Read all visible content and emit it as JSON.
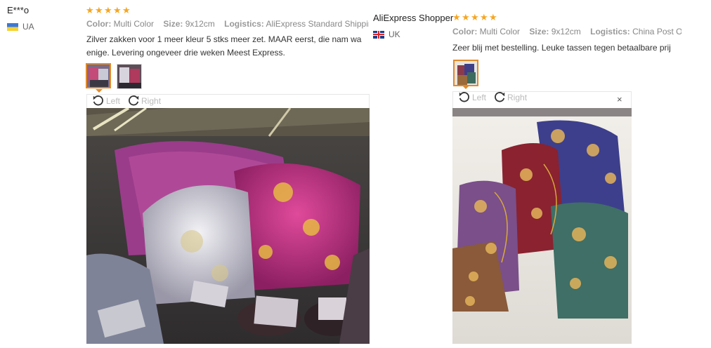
{
  "reviews": [
    {
      "name": "E***o",
      "country": "UA",
      "rating": 5,
      "attrs": {
        "color_key": "Color:",
        "color_val": "Multi Color",
        "size_key": "Size:",
        "size_val": "9x12cm",
        "logistics_key": "Logistics:",
        "logistics_val": "AliExpress Standard Shippin"
      },
      "text_line1": "Zilver zakken voor 1 meer kleur 5 stks meer zet. MAAR eerst, die nam wa",
      "text_line2": "enige. Levering ongeveer drie weken Meest Express.",
      "rotate_left": "Left",
      "rotate_right": "Right"
    },
    {
      "name": "AliExpress Shopper",
      "country": "UK",
      "rating": 5,
      "attrs": {
        "color_key": "Color:",
        "color_val": "Multi Color",
        "size_key": "Size:",
        "size_val": "9x12cm",
        "logistics_key": "Logistics:",
        "logistics_val": "China Post Or"
      },
      "text_line1": "Zeer blij met bestelling. Leuke tassen tegen betaalbare prij",
      "rotate_left": "Left",
      "rotate_right": "Right",
      "close": "×"
    }
  ],
  "colors": {
    "star": "#f5a623",
    "accent": "#e08a2c"
  }
}
